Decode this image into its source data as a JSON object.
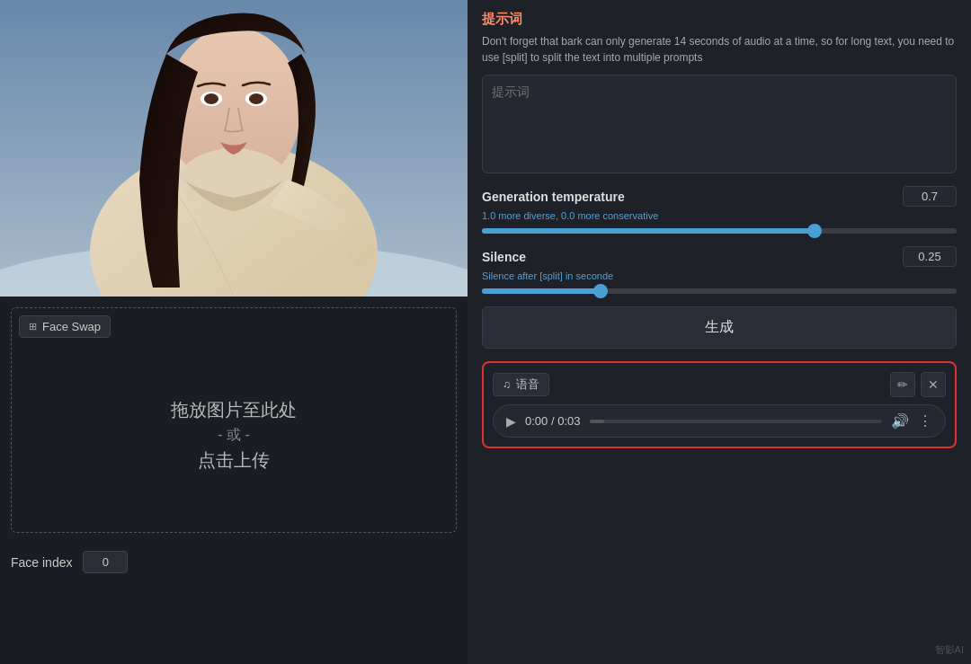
{
  "left": {
    "face_swap_tab": "Face Swap",
    "tab_icon": "⊞",
    "drop_main": "拖放图片至此处",
    "drop_or": "- 或 -",
    "drop_upload": "点击上传",
    "face_index_label": "Face index",
    "face_index_value": "0"
  },
  "right": {
    "prompt_title": "提示词",
    "prompt_desc": "Don't forget that bark can only generate 14 seconds of audio at a time, so for long text, you need to use [split] to split the text into multiple prompts",
    "prompt_placeholder": "提示词",
    "generation_temp_label": "Generation temperature",
    "generation_temp_value": "0.7",
    "generation_temp_hint": "1.0 more diverse, 0.0 more conservative",
    "generation_temp_fill_pct": 70,
    "generation_temp_thumb_pct": 70,
    "silence_label": "Silence",
    "silence_value": "0.25",
    "silence_hint": "Silence after [split] in seconde",
    "silence_fill_pct": 25,
    "silence_thumb_pct": 25,
    "generate_btn": "生成",
    "audio": {
      "label_icon": "♫",
      "label_text": "语音",
      "edit_icon": "✏",
      "close_icon": "✕",
      "play_icon": "▶",
      "time_current": "0:00",
      "time_sep": "/",
      "time_total": "0:03",
      "volume_icon": "🔊",
      "more_icon": "⋮"
    }
  },
  "watermark": "智影AI"
}
